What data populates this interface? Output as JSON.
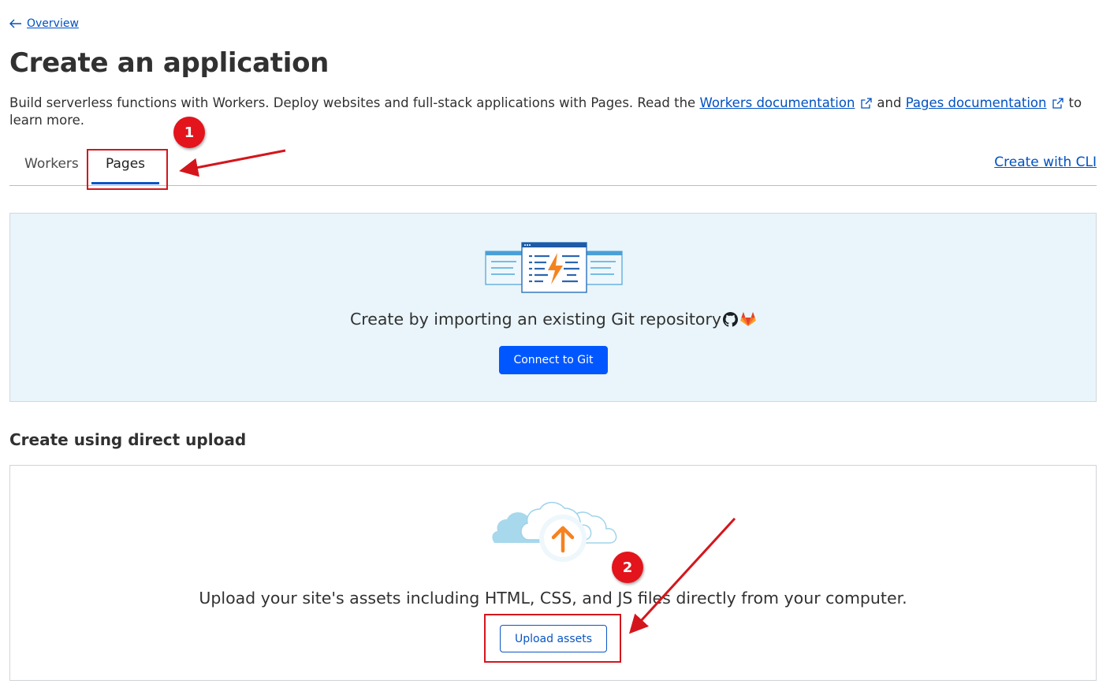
{
  "nav": {
    "back_label": "Overview"
  },
  "page": {
    "title": "Create an application",
    "intro_text": "Build serverless functions with Workers. Deploy websites and full-stack applications with Pages. Read the",
    "workers_doc_link": "Workers documentation",
    "and_text": "and",
    "pages_doc_link": "Pages documentation",
    "outro_text": "to learn more."
  },
  "tabs": {
    "items": [
      {
        "label": "Workers",
        "active": false
      },
      {
        "label": "Pages",
        "active": true
      }
    ],
    "cli_link": "Create with CLI"
  },
  "git_card": {
    "text": "Create by importing an existing Git repository",
    "button_label": "Connect to Git",
    "icons": [
      "github-icon",
      "gitlab-icon"
    ]
  },
  "direct_upload": {
    "heading": "Create using direct upload",
    "text": "Upload your site's assets including HTML, CSS, and JS files directly from your computer.",
    "button_label": "Upload assets"
  },
  "annotations": {
    "badges": [
      "1",
      "2"
    ]
  },
  "colors": {
    "link": "#0051c3",
    "primary_button": "#0057ff",
    "git_card_bg": "#e9f5fa",
    "annotation": "#e3141c",
    "upload_arrow": "#f6821f"
  }
}
